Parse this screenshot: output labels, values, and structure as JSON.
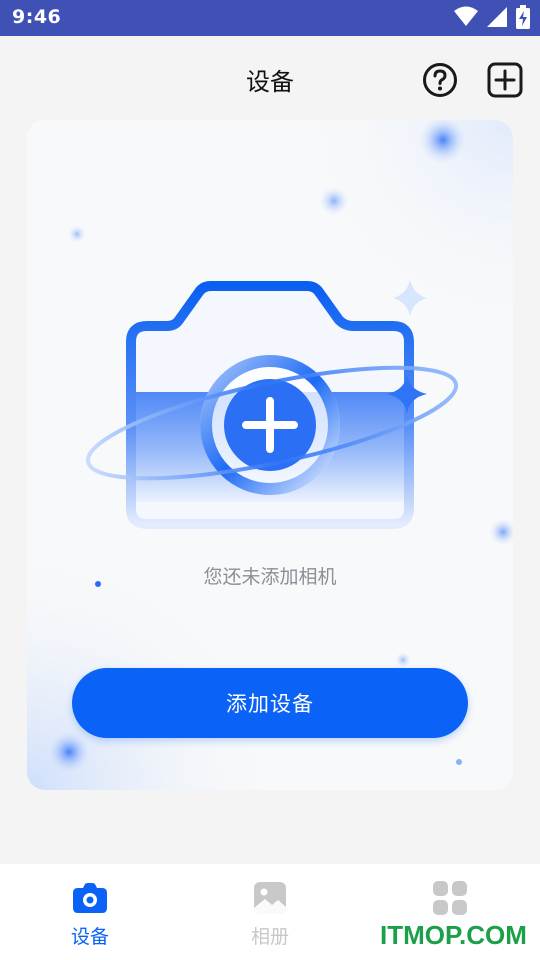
{
  "status_bar": {
    "time": "9:46",
    "icons": [
      "wifi-icon",
      "signal-icon",
      "battery-charging-icon"
    ]
  },
  "header": {
    "title": "设备",
    "help_icon": "help-circle-icon",
    "add_icon": "add-square-icon"
  },
  "empty_state": {
    "message": "您还未添加相机",
    "illustration": "camera-add-illustration",
    "button_label": "添加设备"
  },
  "bottom_nav": {
    "items": [
      {
        "label": "设备",
        "icon": "camera-icon",
        "active": true
      },
      {
        "label": "相册",
        "icon": "gallery-icon",
        "active": false
      },
      {
        "label": "",
        "icon": "grid-icon",
        "active": false
      }
    ]
  },
  "colors": {
    "status_bar": "#3f51b5",
    "accent": "#0a63f6",
    "background": "#f4f4f5",
    "inactive": "#c8c8c8"
  },
  "watermark": "ITMOP.COM"
}
